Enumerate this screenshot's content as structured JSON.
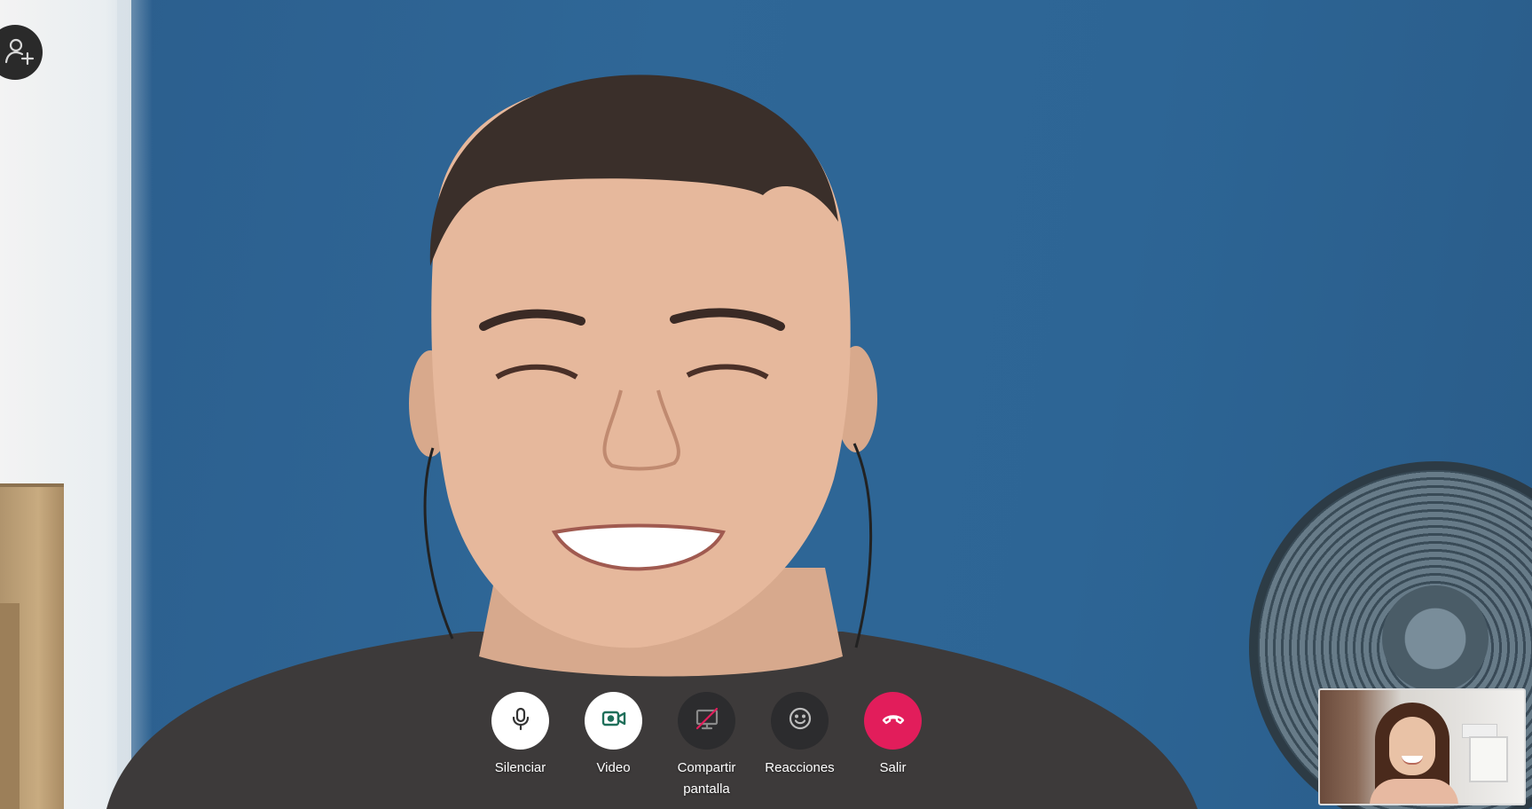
{
  "call": {
    "add_participant_icon": "person-add-icon"
  },
  "controls": [
    {
      "id": "mute",
      "label": "Silenciar",
      "icon": "microphone-icon",
      "style": "light"
    },
    {
      "id": "video",
      "label": "Video",
      "icon": "video-camera-icon",
      "style": "light"
    },
    {
      "id": "share",
      "label": "Compartir pantalla",
      "icon": "screen-share-off-icon",
      "style": "dark"
    },
    {
      "id": "reactions",
      "label": "Reacciones",
      "icon": "smiley-icon",
      "style": "dark"
    },
    {
      "id": "leave",
      "label": "Salir",
      "icon": "hang-up-icon",
      "style": "red"
    }
  ],
  "colors": {
    "leave": "#e21d5b",
    "dark_button": "#2c2c2e",
    "light_button": "#ffffff",
    "video_icon_accent": "#1f6f5a"
  }
}
